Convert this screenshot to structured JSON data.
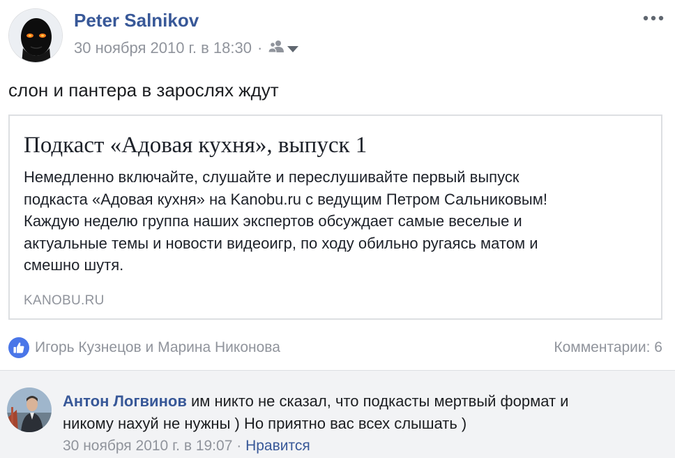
{
  "post": {
    "author": "Peter Salnikov",
    "timestamp": "30 ноября 2010 г. в 18:30",
    "separator": "·",
    "text": "слон и пантера в зарослях ждут",
    "privacy_icon": "friends-icon",
    "more_icon": "more-icon"
  },
  "link_card": {
    "title": "Подкаст «Адовая кухня», выпуск 1",
    "description_lines": [
      "Немедленно включайте, слушайте и переслушивайте первый выпуск",
      "подкаста «Адовая кухня» на Kanobu.ru с ведущим Петром Сальниковым!",
      "Каждую неделю группа наших экспертов обсуждает самые веселые и",
      "актуальные темы и новости видеоигр, по ходу обильно ругаясь матом и",
      "смешно шутя."
    ],
    "domain": "KANOBU.RU"
  },
  "reactions": {
    "icon": "like-icon",
    "names": "Игорь Кузнецов и Марина Никонова",
    "comments_label": "Комментарии: 6"
  },
  "comment": {
    "author": "Антон Логвинов",
    "text_line1": "им никто не сказал, что подкасты мертвый формат и",
    "text_line2": "никому нахуй не нужны ) Но приятно вас всех слышать )",
    "timestamp": "30 ноября 2010 г. в 19:07",
    "separator": "·",
    "like_label": "Нравится"
  },
  "colors": {
    "link_blue": "#385898",
    "meta_gray": "#90949c",
    "like_blue": "#4a76e8",
    "comment_bg": "#f2f3f5"
  }
}
